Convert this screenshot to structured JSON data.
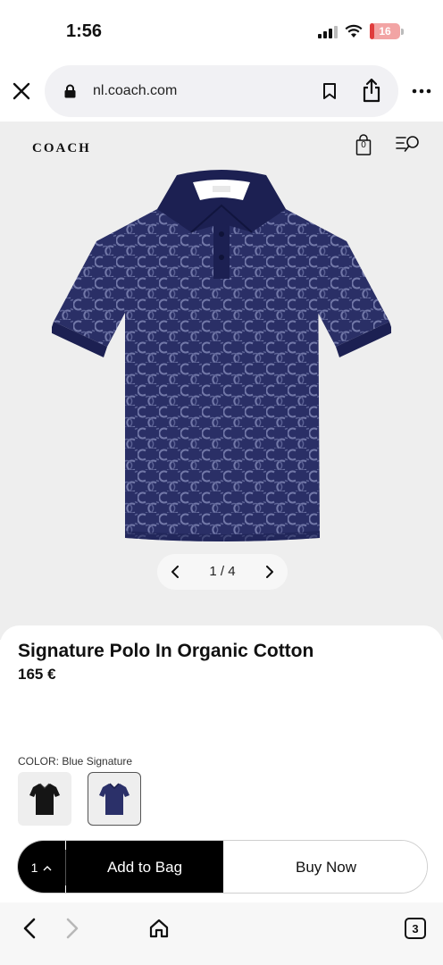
{
  "status_bar": {
    "time": "1:56",
    "battery": "16",
    "battery_level": 0.16
  },
  "browser": {
    "url": "nl.coach.com"
  },
  "site": {
    "logo": "COACH",
    "bag_count": "0"
  },
  "gallery": {
    "pager": "1 / 4"
  },
  "product": {
    "title": "Signature Polo In Organic Cotton",
    "price": "165 €",
    "color_label": "COLOR: Blue Signature",
    "swatches": [
      {
        "name": "black",
        "color": "#151515",
        "selected": false
      },
      {
        "name": "blue-signature",
        "color": "#2b3069",
        "selected": true
      }
    ]
  },
  "cta": {
    "quantity": "1",
    "add_to_bag": "Add to Bag",
    "buy_now": "Buy Now"
  },
  "toolbar": {
    "tabs_count": "3"
  },
  "colors": {
    "polo_base": "#2a2f66",
    "polo_pattern": "#7278a8",
    "collar": "#1c2052",
    "accent_red": "#e03c3c"
  }
}
